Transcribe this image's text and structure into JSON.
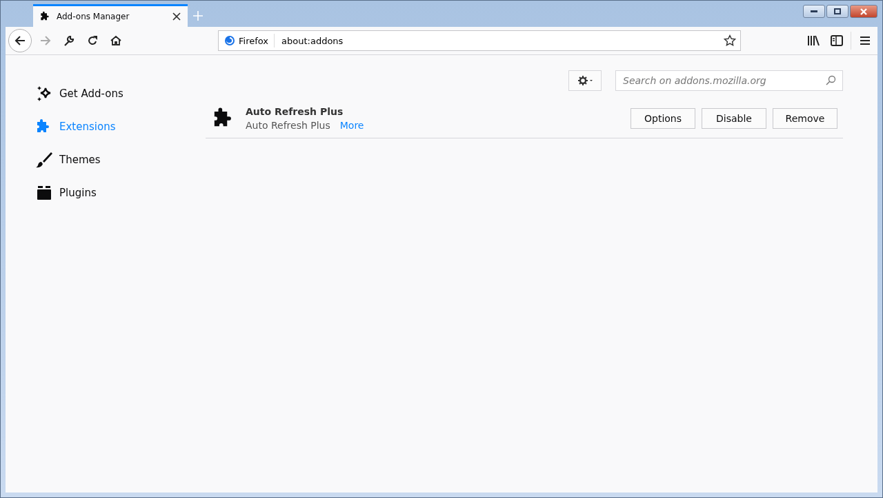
{
  "tab": {
    "title": "Add-ons Manager"
  },
  "address_bar": {
    "identity": "Firefox",
    "url": "about:addons"
  },
  "sidebar": {
    "items": [
      {
        "label": "Get Add-ons",
        "kind": "discover",
        "selected": false
      },
      {
        "label": "Extensions",
        "kind": "extension",
        "selected": true
      },
      {
        "label": "Themes",
        "kind": "theme",
        "selected": false
      },
      {
        "label": "Plugins",
        "kind": "plugin",
        "selected": false
      }
    ]
  },
  "search": {
    "placeholder": "Search on addons.mozilla.org"
  },
  "addons": [
    {
      "name": "Auto Refresh Plus",
      "description": "Auto Refresh Plus",
      "more_link": "More",
      "buttons": [
        "Options",
        "Disable",
        "Remove"
      ]
    }
  ]
}
